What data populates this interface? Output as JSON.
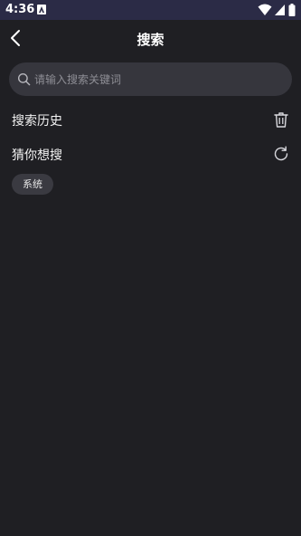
{
  "status_bar": {
    "time": "4:36",
    "icons": [
      "notification-a-icon",
      "wifi-icon",
      "signal-icon",
      "battery-icon"
    ]
  },
  "header": {
    "title": "搜索",
    "back_icon": "chevron-left-icon"
  },
  "search": {
    "placeholder": "请输入搜索关键词",
    "value": ""
  },
  "history": {
    "title": "搜索历史",
    "action_icon": "trash-icon"
  },
  "suggest": {
    "title": "猜你想搜",
    "action_icon": "refresh-icon",
    "tags": [
      "系统"
    ]
  },
  "colors": {
    "background": "#1f1f23",
    "status_bar": "#2b2b46",
    "search_bg": "#36363d",
    "chip_bg": "#3a3a41",
    "text": "#f2f2f2",
    "placeholder": "#8e8e95"
  }
}
